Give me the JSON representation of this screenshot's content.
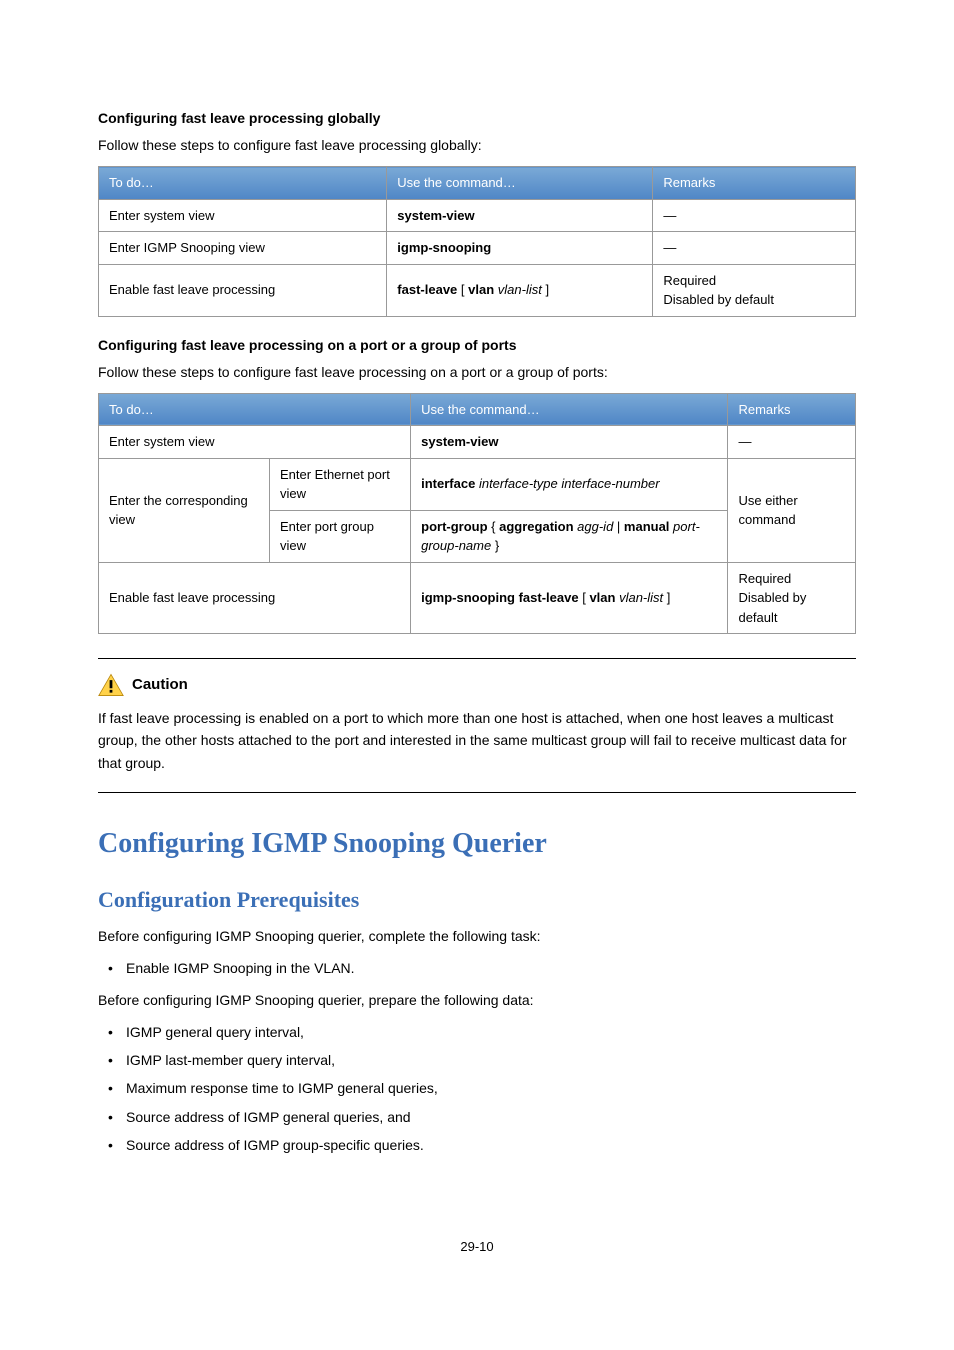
{
  "section1": {
    "title": "Configuring fast leave processing globally",
    "intro": "Follow these steps to configure fast leave processing globally:",
    "headers": [
      "To do…",
      "Use the command…",
      "Remarks"
    ],
    "rows": [
      {
        "todo": "Enter system view",
        "cmd": "system-view",
        "remark": "—"
      },
      {
        "todo": "Enter IGMP Snooping view",
        "cmd": "igmp-snooping",
        "remark": "—"
      },
      {
        "todo": "Enable fast leave processing",
        "cmd": "fast-leave [ vlan vlan-list ]",
        "remark": "Required\nDisabled by default"
      }
    ]
  },
  "section2": {
    "title": "Configuring fast leave processing on a port or a group of ports",
    "intro": "Follow these steps to configure fast leave processing on a port or a group of ports:",
    "headers": [
      "To do…",
      "Use the command…",
      "Remarks"
    ],
    "rows": {
      "r1": {
        "todo": "Enter system view",
        "cmd": "system-view",
        "remark": "—"
      },
      "r2a": {
        "group": "Enter the corresponding view",
        "todo": "Enter Ethernet port view",
        "cmd": "interface interface-type interface-number"
      },
      "r2b": {
        "todo": "Enter port group view",
        "cmd": "port-group { aggregation agg-id | manual port-group-name }"
      },
      "r2remark": "Use either command",
      "r3": {
        "todo": "Enable fast leave processing",
        "cmd": "igmp-snooping fast-leave [ vlan vlan-list ]",
        "remark": "Required\nDisabled by default"
      }
    }
  },
  "caution": {
    "label": "Caution",
    "text": "If fast leave processing is enabled on a port to which more than one host is attached, when one host leaves a multicast group, the other hosts attached to the port and interested in the same multicast group will fail to receive multicast data for that group."
  },
  "h1": "Configuring IGMP Snooping Querier",
  "h2": "Configuration Prerequisites",
  "prereq": {
    "line1": "Before configuring IGMP Snooping querier, complete the following task:",
    "list1": [
      "Enable IGMP Snooping in the VLAN."
    ],
    "line2": "Before configuring IGMP Snooping querier, prepare the following data:",
    "list2": [
      "IGMP general query interval,",
      "IGMP last-member query interval,",
      "Maximum response time to IGMP general queries,",
      "Source address of IGMP general queries, and",
      "Source address of IGMP group-specific queries."
    ]
  },
  "pagenum": "29-10"
}
